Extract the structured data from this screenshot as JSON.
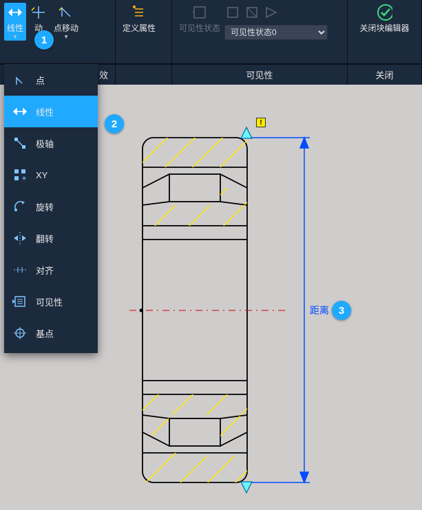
{
  "ribbon": {
    "panel1": {
      "b1": {
        "label": "线性"
      },
      "b2": {
        "label": "动"
      },
      "b3": {
        "label": "点移动"
      }
    },
    "panel2": {
      "b1": {
        "label": "定义属性"
      }
    },
    "panel3": {
      "b1": {
        "label": "可见性状态"
      },
      "combo_value": "可见性状态0"
    },
    "panel4": {
      "b1": {
        "label": "关闭块编辑器"
      }
    }
  },
  "ribbon2": {
    "c1": "效",
    "c2": "可见性",
    "c3": "关闭"
  },
  "dropdown": {
    "items": [
      {
        "label": "点"
      },
      {
        "label": "线性"
      },
      {
        "label": "极轴"
      },
      {
        "label": "XY"
      },
      {
        "label": "旋转"
      },
      {
        "label": "翻转"
      },
      {
        "label": "对齐"
      },
      {
        "label": "可见性"
      },
      {
        "label": "基点"
      }
    ]
  },
  "canvas": {
    "dimension_label": "距离",
    "warning_glyph": "!"
  },
  "callouts": {
    "c1": "1",
    "c2": "2",
    "c3": "3"
  }
}
